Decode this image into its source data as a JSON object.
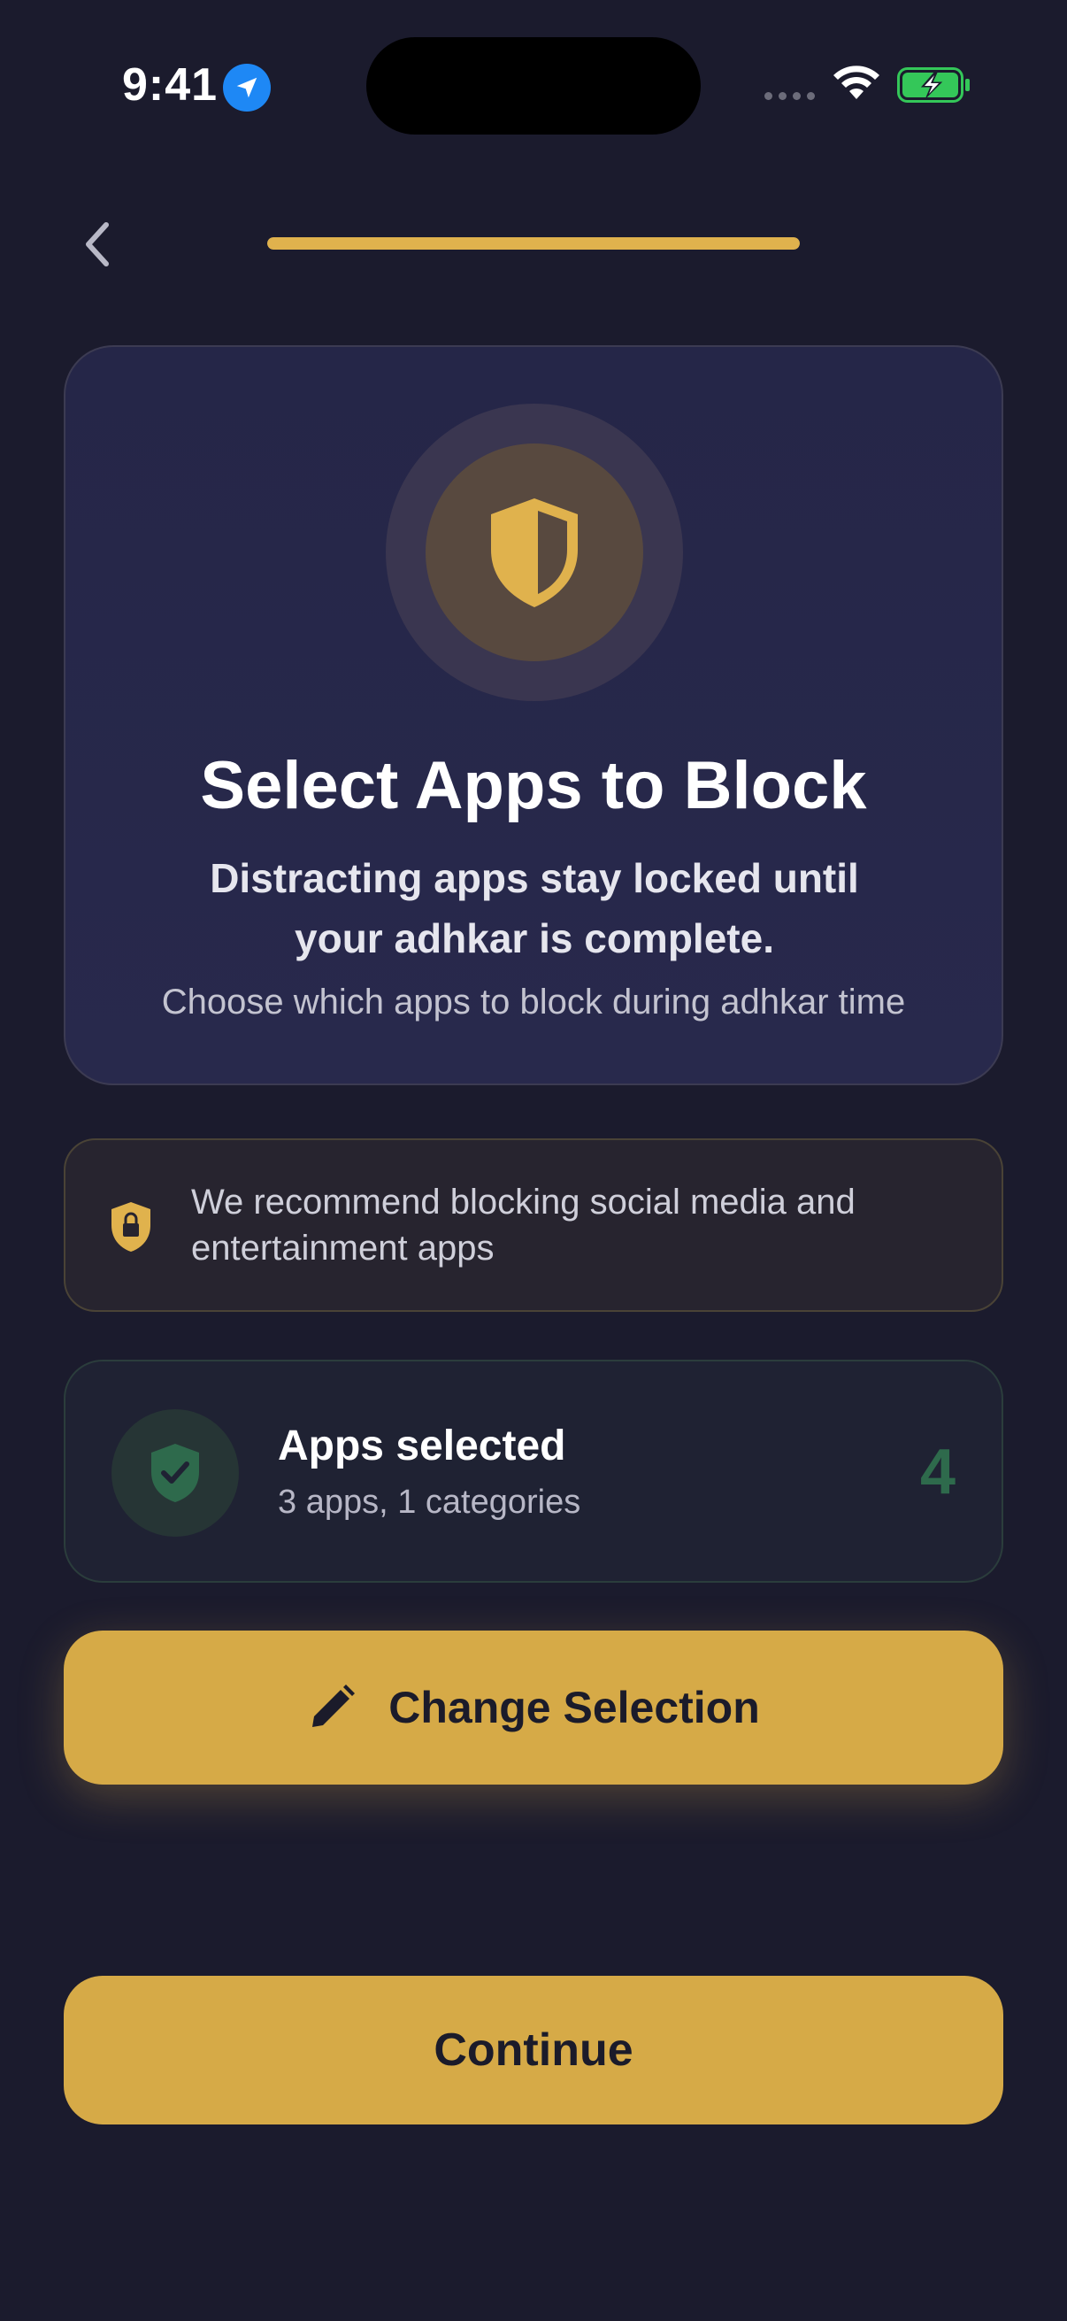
{
  "status_bar": {
    "time": "9:41",
    "icons": [
      "location-arrow-icon",
      "signal-dots-icon",
      "wifi-icon",
      "battery-charging-icon"
    ]
  },
  "nav": {
    "back_icon": "chevron-left-icon",
    "progress": 1.0
  },
  "hero": {
    "icon": "shield-icon",
    "title": "Select Apps to Block",
    "subtitle": "Distracting apps stay locked until your adhkar is complete.",
    "caption": "Choose which apps to block during adhkar time"
  },
  "recommendation": {
    "icon": "shield-lock-icon",
    "text": "We recommend blocking social media and entertainment apps"
  },
  "selection": {
    "icon": "shield-check-icon",
    "title": "Apps selected",
    "summary": "3 apps, 1 categories",
    "count": "4"
  },
  "buttons": {
    "change_icon": "pencil-icon",
    "change_label": "Change Selection",
    "continue_label": "Continue"
  },
  "colors": {
    "background": "#1b1b2d",
    "accent_gold": "#d6aa47",
    "success_green": "#2e6a4c",
    "status_location_blue": "#1e88f5",
    "battery_green": "#34c759"
  }
}
